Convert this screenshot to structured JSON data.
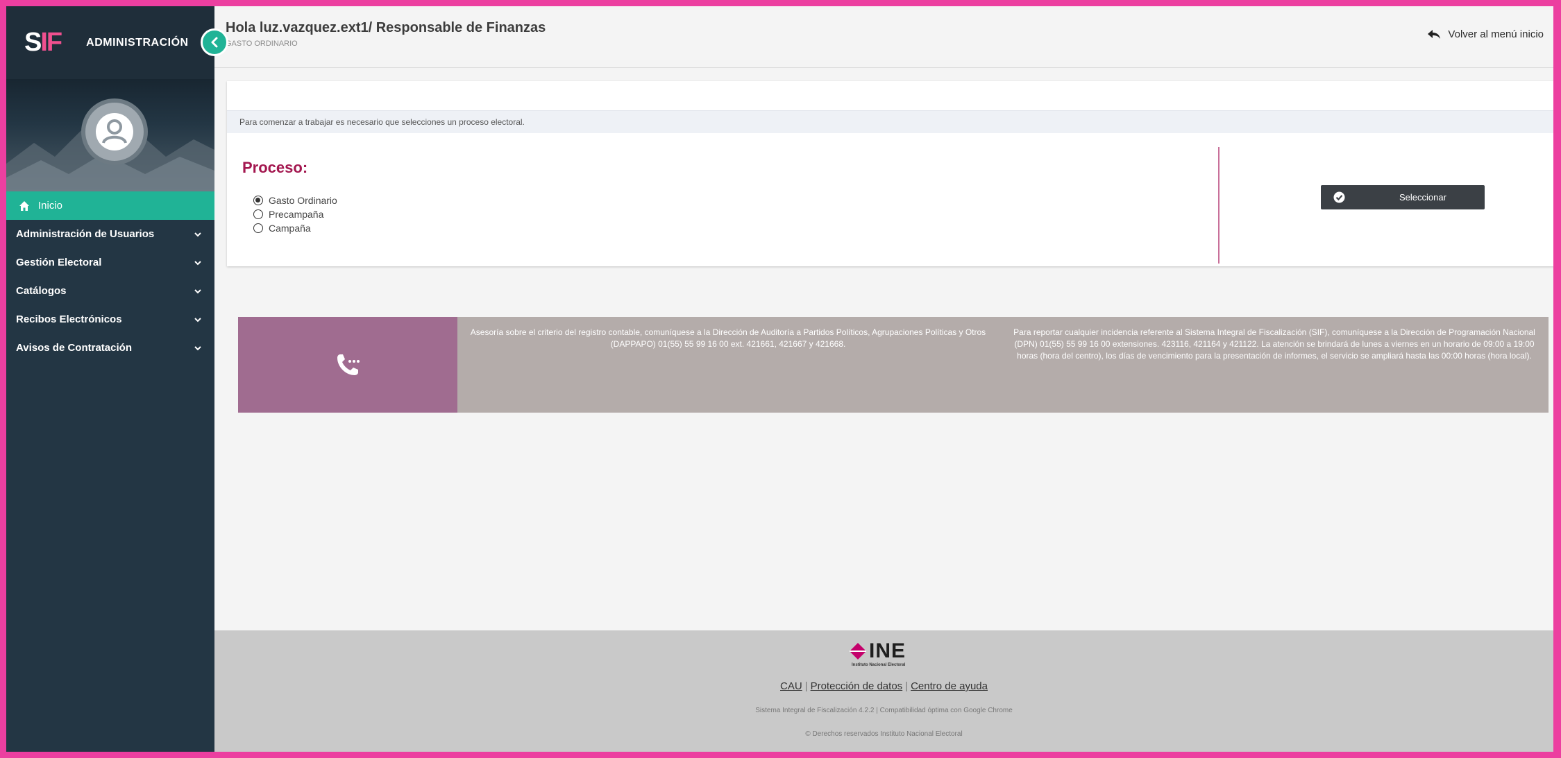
{
  "colors": {
    "frame": "#ec3fa0",
    "sidebar": "#233644",
    "accent_green": "#20b396",
    "title_magenta": "#a3174f",
    "help_purple": "#a06c90",
    "help_gray": "#b4acaa"
  },
  "brand": {
    "logo_s": "S",
    "logo_i": "I",
    "logo_f": "F",
    "title": "ADMINISTRACIÓN"
  },
  "sidebar": {
    "items": [
      {
        "label": "Inicio",
        "icon": "home-icon",
        "active": true
      },
      {
        "label": "Administración de Usuarios",
        "icon": "chevron-down-icon"
      },
      {
        "label": "Gestión Electoral",
        "icon": "chevron-down-icon"
      },
      {
        "label": "Catálogos",
        "icon": "chevron-down-icon"
      },
      {
        "label": "Recibos Electrónicos",
        "icon": "chevron-down-icon"
      },
      {
        "label": "Avisos de Contratación",
        "icon": "chevron-down-icon"
      }
    ]
  },
  "header": {
    "greeting": "Hola luz.vazquez.ext1/ Responsable de Finanzas",
    "subtitle": "GASTO ORDINARIO",
    "back_link": "Volver al menú inicio"
  },
  "process": {
    "note": "Para comenzar a trabajar es necesario que selecciones un proceso electoral.",
    "title": "Proceso:",
    "options": [
      "Gasto Ordinario",
      "Precampaña",
      "Campaña"
    ],
    "selected": "Gasto Ordinario",
    "select_button": "Seleccionar"
  },
  "help": {
    "text_a": "Asesoría sobre el criterio del registro contable, comuníquese a la Dirección de Auditoría a Partidos Políticos, Agrupaciones Políticas y Otros (DAPPAPO) 01(55) 55 99 16 00 ext. 421661, 421667 y 421668.",
    "text_b": "Para reportar cualquier incidencia referente al Sistema Integral de Fiscalización (SIF), comuníquese a la Dirección de Programación Nacional (DPN) 01(55) 55 99 16 00 extensiones. 423116, 421164 y 421122. La atención se brindará de lunes a viernes en un horario de 09:00 a 19:00 horas (hora del centro), los días de vencimiento para la presentación de informes, el servicio se ampliará hasta las 00:00 horas (hora local)."
  },
  "footer": {
    "logo_word": "INE",
    "logo_sub": "Instituto Nacional Electoral",
    "links": [
      "CAU",
      "Protección de datos",
      "Centro de ayuda"
    ],
    "line1": "Sistema Integral de Fiscalización 4.2.2 | Compatibilidad óptima con Google Chrome",
    "line2": "© Derechos reservados Instituto Nacional Electoral"
  }
}
